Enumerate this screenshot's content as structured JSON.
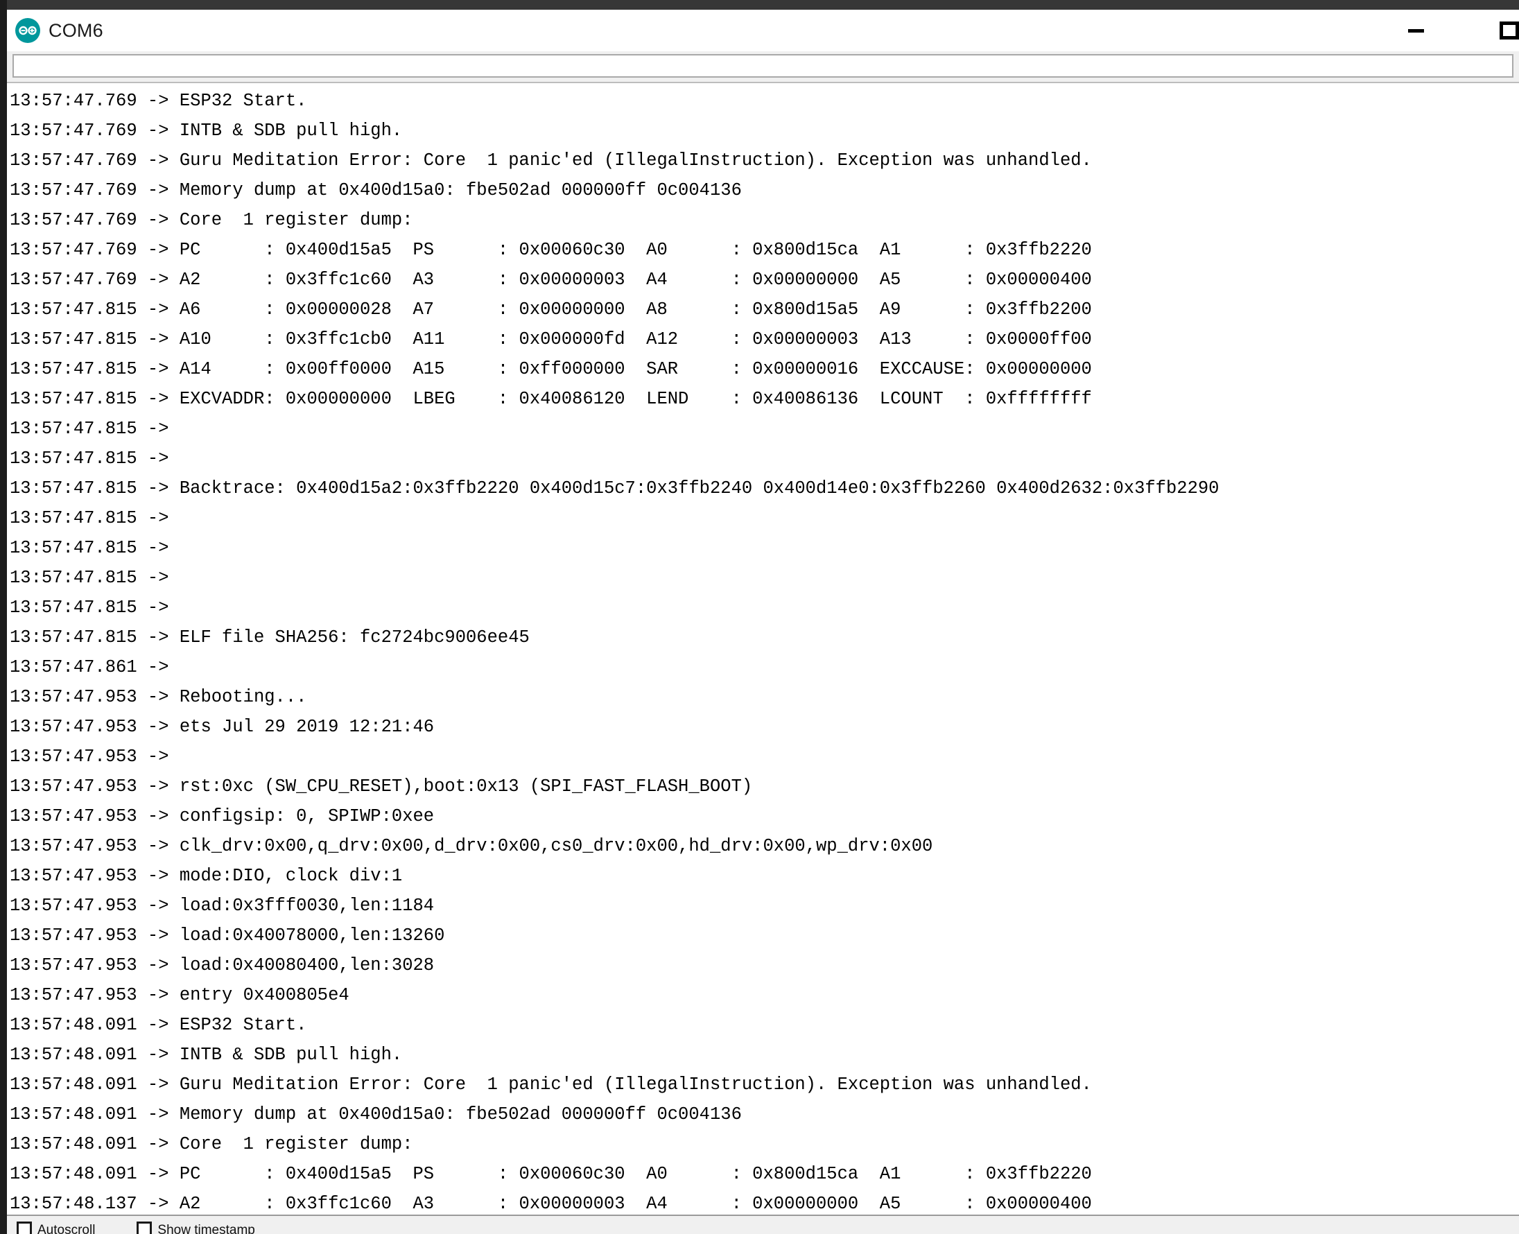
{
  "window": {
    "title": "COM6",
    "logo_icon": "arduino-infinity-icon",
    "accent_color": "#00979c",
    "controls": {
      "minimize_label": "Minimize",
      "maximize_label": "Maximize"
    }
  },
  "send_bar": {
    "value": "",
    "placeholder": ""
  },
  "status_bar": {
    "autoscroll_label": "Autoscroll",
    "timestamp_label": "Show timestamp"
  },
  "log": {
    "lines": [
      "13:57:47.769 -> ESP32 Start.",
      "13:57:47.769 -> INTB & SDB pull high.",
      "13:57:47.769 -> Guru Meditation Error: Core  1 panic'ed (IllegalInstruction). Exception was unhandled.",
      "13:57:47.769 -> Memory dump at 0x400d15a0: fbe502ad 000000ff 0c004136",
      "13:57:47.769 -> Core  1 register dump:",
      "13:57:47.769 -> PC      : 0x400d15a5  PS      : 0x00060c30  A0      : 0x800d15ca  A1      : 0x3ffb2220",
      "13:57:47.769 -> A2      : 0x3ffc1c60  A3      : 0x00000003  A4      : 0x00000000  A5      : 0x00000400",
      "13:57:47.815 -> A6      : 0x00000028  A7      : 0x00000000  A8      : 0x800d15a5  A9      : 0x3ffb2200",
      "13:57:47.815 -> A10     : 0x3ffc1cb0  A11     : 0x000000fd  A12     : 0x00000003  A13     : 0x0000ff00",
      "13:57:47.815 -> A14     : 0x00ff0000  A15     : 0xff000000  SAR     : 0x00000016  EXCCAUSE: 0x00000000",
      "13:57:47.815 -> EXCVADDR: 0x00000000  LBEG    : 0x40086120  LEND    : 0x40086136  LCOUNT  : 0xffffffff",
      "13:57:47.815 ->",
      "13:57:47.815 ->",
      "13:57:47.815 -> Backtrace: 0x400d15a2:0x3ffb2220 0x400d15c7:0x3ffb2240 0x400d14e0:0x3ffb2260 0x400d2632:0x3ffb2290",
      "13:57:47.815 ->",
      "13:57:47.815 ->",
      "13:57:47.815 ->",
      "13:57:47.815 ->",
      "13:57:47.815 -> ELF file SHA256: fc2724bc9006ee45",
      "13:57:47.861 ->",
      "13:57:47.953 -> Rebooting...",
      "13:57:47.953 -> ets Jul 29 2019 12:21:46",
      "13:57:47.953 ->",
      "13:57:47.953 -> rst:0xc (SW_CPU_RESET),boot:0x13 (SPI_FAST_FLASH_BOOT)",
      "13:57:47.953 -> configsip: 0, SPIWP:0xee",
      "13:57:47.953 -> clk_drv:0x00,q_drv:0x00,d_drv:0x00,cs0_drv:0x00,hd_drv:0x00,wp_drv:0x00",
      "13:57:47.953 -> mode:DIO, clock div:1",
      "13:57:47.953 -> load:0x3fff0030,len:1184",
      "13:57:47.953 -> load:0x40078000,len:13260",
      "13:57:47.953 -> load:0x40080400,len:3028",
      "13:57:47.953 -> entry 0x400805e4",
      "13:57:48.091 -> ESP32 Start.",
      "13:57:48.091 -> INTB & SDB pull high.",
      "13:57:48.091 -> Guru Meditation Error: Core  1 panic'ed (IllegalInstruction). Exception was unhandled.",
      "13:57:48.091 -> Memory dump at 0x400d15a0: fbe502ad 000000ff 0c004136",
      "13:57:48.091 -> Core  1 register dump:",
      "13:57:48.091 -> PC      : 0x400d15a5  PS      : 0x00060c30  A0      : 0x800d15ca  A1      : 0x3ffb2220",
      "13:57:48.137 -> A2      : 0x3ffc1c60  A3      : 0x00000003  A4      : 0x00000000  A5      : 0x00000400"
    ]
  }
}
